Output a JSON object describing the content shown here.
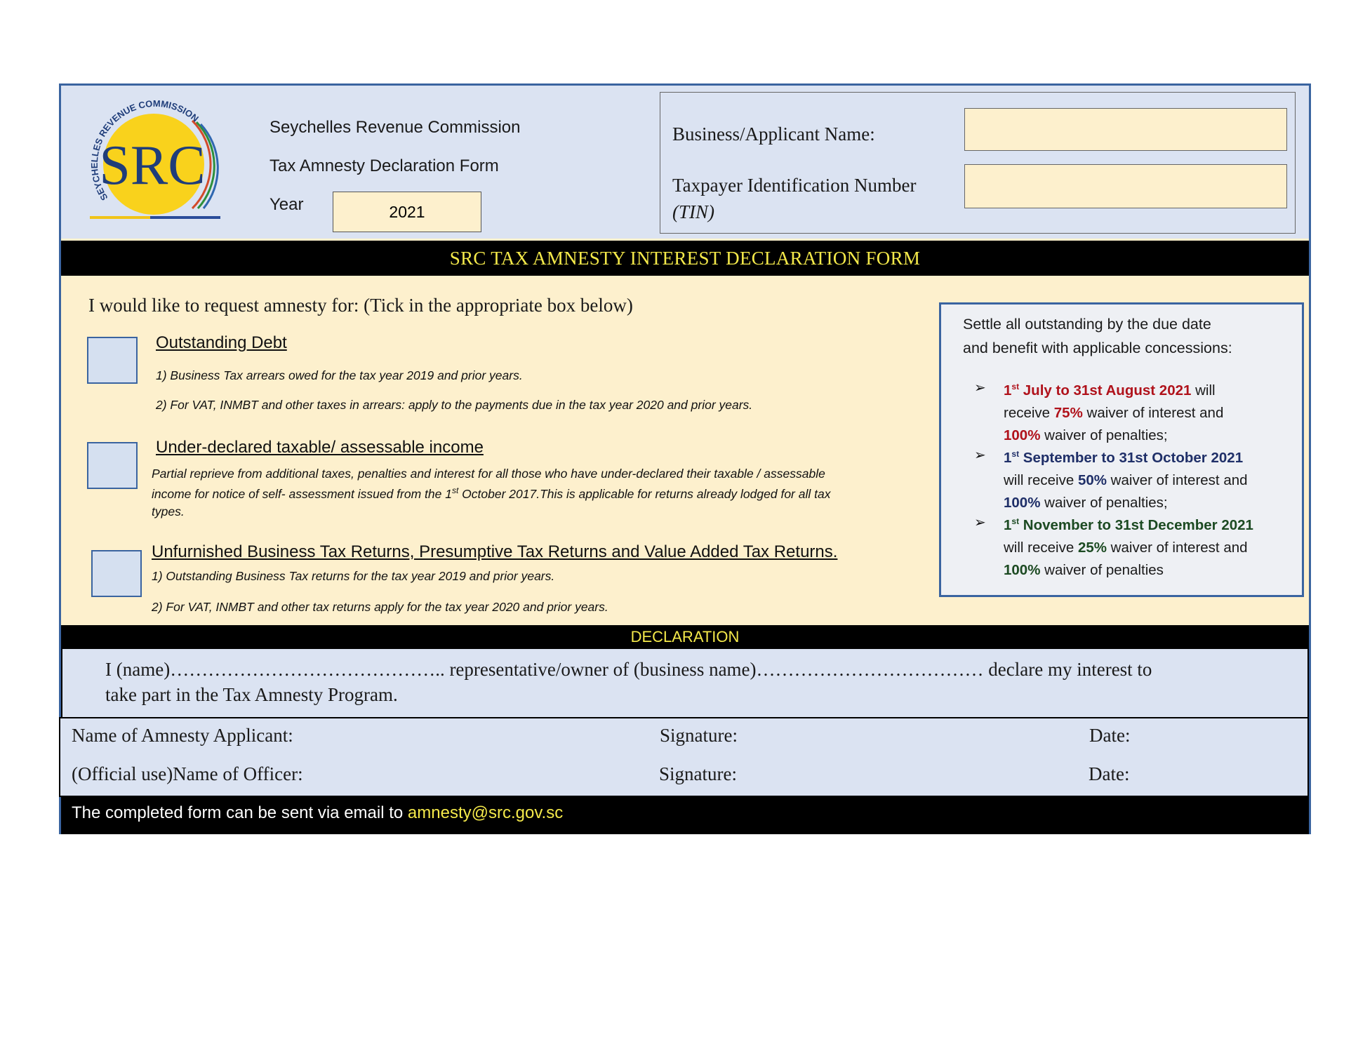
{
  "header": {
    "org_name": "Seychelles Revenue Commission",
    "form_name": "Tax Amnesty Declaration Form",
    "year_label": "Year",
    "year_value": "2021",
    "logo_letters": "SRC",
    "logo_ring_text": "SEYCHELLES REVENUE COMMISSION",
    "business_name_label": "Business/Applicant Name:",
    "tin_label": "Taxpayer Identification Number",
    "tin_abbr": "(TIN)"
  },
  "title": "SRC TAX AMNESTY INTEREST DECLARATION FORM",
  "options": {
    "intro": "I would like to request amnesty for: (Tick in the appropriate box below)",
    "outstanding_debt": {
      "heading": "Outstanding Debt",
      "line1": "1) Business Tax arrears owed for the tax year 2019 and prior years.",
      "line2": "2) For VAT, INMBT and other taxes in arrears: apply to the payments due in the tax year 2020 and prior years."
    },
    "under_declared": {
      "heading": "Under-declared taxable/ assessable income",
      "line1": "Partial reprieve from additional taxes, penalties and interest for all those who have under-declared their taxable / assessable",
      "line2_a": "income for notice of self- assessment issued from the 1",
      "line2_sup": "st",
      "line2_b": " October 2017.This is applicable for returns already lodged for all tax",
      "line3": "types."
    },
    "unfurnished": {
      "heading": "Unfurnished Business Tax Returns, Presumptive Tax Returns and Value Added Tax Returns.",
      "line1": "1) Outstanding Business Tax returns for the tax year 2019 and prior years.",
      "line2": "2) For VAT, INMBT and other tax returns apply for the tax year 2020 and prior years."
    }
  },
  "concessions": {
    "intro_line1": "Settle all outstanding by the due date",
    "intro_line2": "and benefit with applicable concessions:",
    "items": [
      {
        "period_a": "1",
        "period_sup": "st",
        "period_b": " July to 31st  August 2021",
        "text1": " will",
        "text2_a": "receive ",
        "pct": "75%",
        "text2_b": " waiver of interest and",
        "pen": "100%",
        "text3": " waiver of penalties;"
      },
      {
        "period_a": "1",
        "period_sup": "st",
        "period_b": " September to 31st  October 2021",
        "text2_a": "will receive ",
        "pct": "50%",
        "text2_b": " waiver of interest and",
        "pen": "100%",
        "text3": " waiver of penalties;"
      },
      {
        "period_a": "1",
        "period_sup": "st",
        "period_b": " November to 31st December 2021",
        "text2_a": "will receive ",
        "pct": "25%",
        "text2_b": " waiver of interest and",
        "pen": "100%",
        "text3": " waiver of penalties"
      }
    ],
    "bullet": "➢",
    "colors": {
      "period1": "#b0121b",
      "period2": "#1f2f68",
      "period3": "#1c4a22"
    }
  },
  "declaration": {
    "title": "DECLARATION",
    "line1": "I (name)…………………………………….. representative/owner of (business name)……………………………… declare my interest to",
    "line2": "take part in the Tax Amnesty Program."
  },
  "signatures": {
    "applicant_label": "Name of Amnesty Applicant:",
    "officer_label": "(Official use)Name of Officer:",
    "signature_label": "Signature:",
    "date_label": "Date:"
  },
  "footer": {
    "text": "The completed form can be sent via email to ",
    "email": "amnesty@src.gov.sc"
  },
  "colors": {
    "header_bg": "#dbe3f2",
    "form_bg": "#fdf0cd",
    "accent_blue": "#3a64a0",
    "title_yellow": "#f4e94a"
  }
}
